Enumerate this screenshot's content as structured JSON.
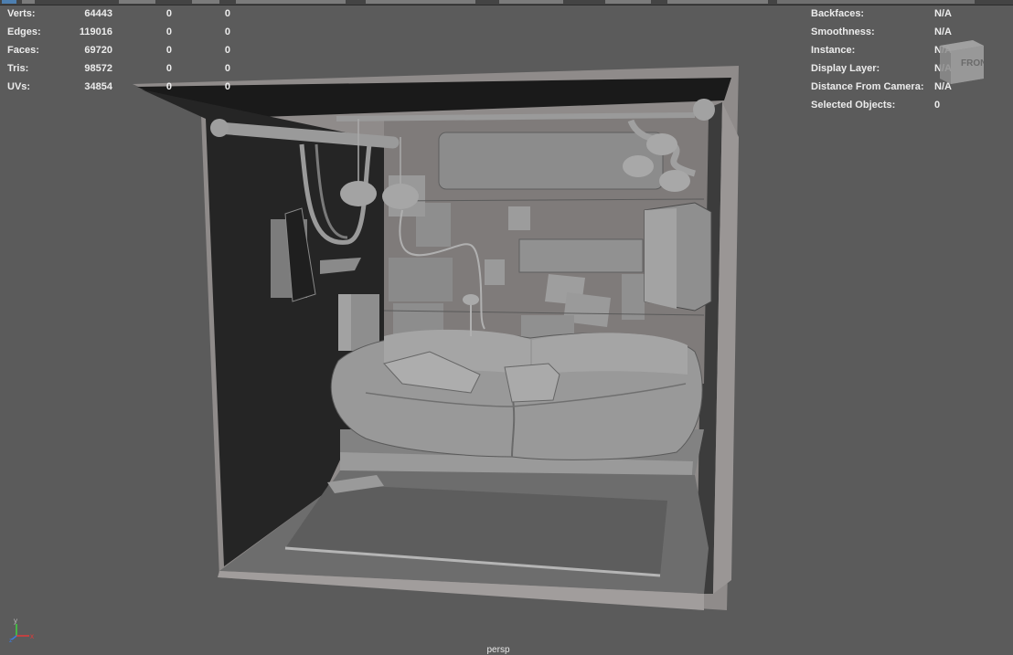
{
  "hud_stats": {
    "rows": [
      {
        "label": "Verts:",
        "value": "64443",
        "c2": "0",
        "c3": "0"
      },
      {
        "label": "Edges:",
        "value": "119016",
        "c2": "0",
        "c3": "0"
      },
      {
        "label": "Faces:",
        "value": "69720",
        "c2": "0",
        "c3": "0"
      },
      {
        "label": "Tris:",
        "value": "98572",
        "c2": "0",
        "c3": "0"
      },
      {
        "label": "UVs:",
        "value": "34854",
        "c2": "0",
        "c3": "0"
      }
    ]
  },
  "hud_object": {
    "rows": [
      {
        "label": "Backfaces:",
        "value": "N/A"
      },
      {
        "label": "Smoothness:",
        "value": "N/A"
      },
      {
        "label": "Instance:",
        "value": "N/A"
      },
      {
        "label": "Display Layer:",
        "value": "N/A"
      },
      {
        "label": "Distance From Camera:",
        "value": "N/A"
      },
      {
        "label": "Selected Objects:",
        "value": "0"
      }
    ]
  },
  "viewcube": {
    "face_label": "FRONT"
  },
  "viewport": {
    "camera": "persp"
  },
  "axis_gizmo": {
    "x": "x",
    "y": "y",
    "z": "z"
  },
  "icons": [
    "viewcube-icon",
    "axis-gizmo-icon"
  ],
  "colors": {
    "background": "#5b5b5b",
    "hud_text": "#ececec",
    "shell": "#8f8b8a",
    "interior_dark": "#252525",
    "mesh": "#8e8e8e"
  }
}
